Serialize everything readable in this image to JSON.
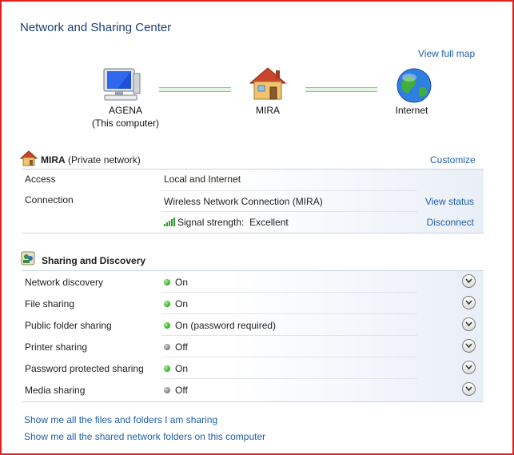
{
  "window": {
    "title": "Network and Sharing Center",
    "view_full_map": "View full map"
  },
  "map": {
    "computer": {
      "name": "AGENA",
      "sub": "(This computer)"
    },
    "network": {
      "name": "MIRA"
    },
    "internet": {
      "name": "Internet"
    }
  },
  "network": {
    "name": "MIRA",
    "type": "(Private network)",
    "customize": "Customize",
    "rows": {
      "access": {
        "label": "Access",
        "value": "Local and Internet"
      },
      "connection": {
        "label": "Connection",
        "value": "Wireless Network Connection (MIRA)",
        "action": "View status"
      },
      "signal": {
        "label": "Signal strength:",
        "value": "Excellent",
        "action": "Disconnect"
      }
    }
  },
  "sharing": {
    "title": "Sharing and Discovery",
    "items": [
      {
        "label": "Network discovery",
        "value": "On",
        "state": "on"
      },
      {
        "label": "File sharing",
        "value": "On",
        "state": "on"
      },
      {
        "label": "Public folder sharing",
        "value": "On (password required)",
        "state": "on"
      },
      {
        "label": "Printer sharing",
        "value": "Off",
        "state": "off"
      },
      {
        "label": "Password protected sharing",
        "value": "On",
        "state": "on"
      },
      {
        "label": "Media sharing",
        "value": "Off",
        "state": "off"
      }
    ]
  },
  "links": {
    "files": "Show me all the files and folders I am sharing",
    "folders": "Show me all the shared network folders on this computer"
  }
}
